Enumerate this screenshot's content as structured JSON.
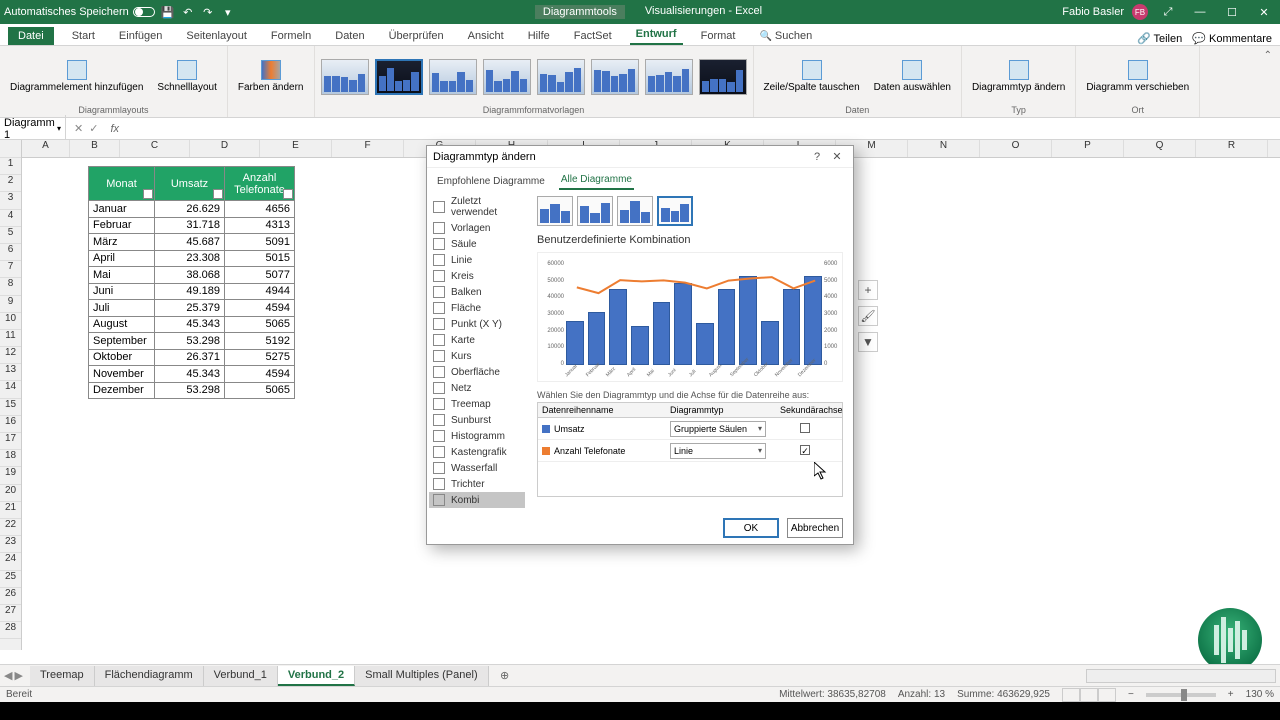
{
  "titlebar": {
    "autosave": "Automatisches Speichern",
    "tool_context": "Diagrammtools",
    "doc_title": "Visualisierungen  -  Excel",
    "user": "Fabio Basler",
    "user_initials": "FB"
  },
  "ribbon_tabs": {
    "file": "Datei",
    "start": "Start",
    "insert": "Einfügen",
    "pagelayout": "Seitenlayout",
    "formulas": "Formeln",
    "data": "Daten",
    "review": "Überprüfen",
    "view": "Ansicht",
    "help": "Hilfe",
    "factset": "FactSet",
    "design": "Entwurf",
    "format": "Format",
    "search": "Suchen",
    "share": "Teilen",
    "comments": "Kommentare"
  },
  "ribbon": {
    "add_element": "Diagrammelement hinzufügen",
    "quicklayout": "Schnelllayout",
    "colors": "Farben ändern",
    "group_layouts": "Diagrammlayouts",
    "group_styles": "Diagrammformatvorlagen",
    "switch_rowcol": "Zeile/Spalte tauschen",
    "select_data": "Daten auswählen",
    "group_data": "Daten",
    "change_type": "Diagrammtyp ändern",
    "group_type": "Typ",
    "move_chart": "Diagramm verschieben",
    "group_loc": "Ort"
  },
  "namebox": "Diagramm 1",
  "col_letters": [
    "A",
    "B",
    "C",
    "D",
    "E",
    "F",
    "G",
    "H",
    "I",
    "J",
    "K",
    "L",
    "M",
    "N",
    "O",
    "P",
    "Q",
    "R"
  ],
  "table": {
    "headers": {
      "month": "Monat",
      "revenue": "Umsatz",
      "calls": "Anzahl Telefonate"
    },
    "rows": [
      {
        "month": "Januar",
        "revenue": "26.629",
        "calls": "4656"
      },
      {
        "month": "Februar",
        "revenue": "31.718",
        "calls": "4313"
      },
      {
        "month": "März",
        "revenue": "45.687",
        "calls": "5091"
      },
      {
        "month": "April",
        "revenue": "23.308",
        "calls": "5015"
      },
      {
        "month": "Mai",
        "revenue": "38.068",
        "calls": "5077"
      },
      {
        "month": "Juni",
        "revenue": "49.189",
        "calls": "4944"
      },
      {
        "month": "Juli",
        "revenue": "25.379",
        "calls": "4594"
      },
      {
        "month": "August",
        "revenue": "45.343",
        "calls": "5065"
      },
      {
        "month": "September",
        "revenue": "53.298",
        "calls": "5192"
      },
      {
        "month": "Oktober",
        "revenue": "26.371",
        "calls": "5275"
      },
      {
        "month": "November",
        "revenue": "45.343",
        "calls": "4594"
      },
      {
        "month": "Dezember",
        "revenue": "53.298",
        "calls": "5065"
      }
    ]
  },
  "dialog": {
    "title": "Diagrammtyp ändern",
    "tabs": {
      "recommended": "Empfohlene Diagramme",
      "all": "Alle Diagramme"
    },
    "type_list": [
      "Zuletzt verwendet",
      "Vorlagen",
      "Säule",
      "Linie",
      "Kreis",
      "Balken",
      "Fläche",
      "Punkt (X Y)",
      "Karte",
      "Kurs",
      "Oberfläche",
      "Netz",
      "Treemap",
      "Sunburst",
      "Histogramm",
      "Kastengrafik",
      "Wasserfall",
      "Trichter",
      "Kombi"
    ],
    "type_selected_idx": 18,
    "combo_title": "Benutzerdefinierte Kombination",
    "instruction": "Wählen Sie den Diagrammtyp und die Achse für die Datenreihe aus:",
    "cols": {
      "name": "Datenreihenname",
      "type": "Diagrammtyp",
      "secondary": "Sekundärachse"
    },
    "series": [
      {
        "name": "Umsatz",
        "type": "Gruppierte Säulen",
        "color": "#4472c4",
        "secondary": false
      },
      {
        "name": "Anzahl Telefonate",
        "type": "Linie",
        "color": "#ed7d31",
        "secondary": true
      }
    ],
    "ok": "OK",
    "cancel": "Abbrechen"
  },
  "chart_data": {
    "type": "combo",
    "title": "",
    "categories": [
      "Januar",
      "Februar",
      "März",
      "April",
      "Mai",
      "Juni",
      "Juli",
      "August",
      "September",
      "Oktober",
      "November",
      "Dezember"
    ],
    "series": [
      {
        "name": "Umsatz",
        "type": "bar",
        "axis": "primary",
        "values": [
          26629,
          31718,
          45687,
          23308,
          38068,
          49189,
          25379,
          45343,
          53298,
          26371,
          45343,
          53298
        ]
      },
      {
        "name": "Anzahl Telefonate",
        "type": "line",
        "axis": "secondary",
        "values": [
          4656,
          4313,
          5091,
          5015,
          5077,
          4944,
          4594,
          5065,
          5192,
          5275,
          4594,
          5065
        ]
      }
    ],
    "y_primary": {
      "min": 0,
      "max": 60000,
      "ticks": [
        10000,
        20000,
        30000,
        40000,
        50000,
        60000
      ],
      "label": ""
    },
    "y_secondary": {
      "min": 0,
      "max": 6000,
      "ticks": [
        1000,
        2000,
        3000,
        4000,
        5000,
        6000
      ],
      "label": ""
    }
  },
  "sheets": [
    "Treemap",
    "Flächendiagramm",
    "Verbund_1",
    "Verbund_2",
    "Small Multiples (Panel)"
  ],
  "active_sheet_idx": 3,
  "status": {
    "ready": "Bereit",
    "avg_label": "Mittelwert:",
    "avg_val": "38635,82708",
    "count_label": "Anzahl:",
    "count_val": "13",
    "sum_label": "Summe:",
    "sum_val": "463629,925",
    "zoom": "130 %"
  }
}
